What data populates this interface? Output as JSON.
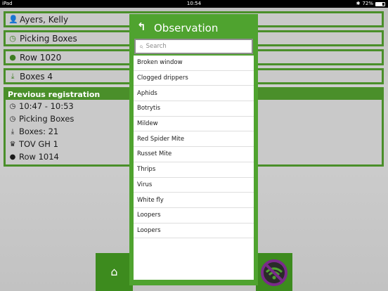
{
  "status_bar": {
    "carrier": "iPad",
    "time": "10:54",
    "battery": "72%"
  },
  "info": {
    "user": "Ayers, Kelly",
    "activity": "Picking Boxes",
    "row": "Row 1020",
    "boxes": "Boxes 4"
  },
  "previous": {
    "header": "Previous registration",
    "time_range": "10:47 - 10:53",
    "activity": "Picking Boxes",
    "boxes": "Boxes: 21",
    "location": "TOV GH 1",
    "row": "Row 1014"
  },
  "dialog": {
    "title": "Observation",
    "search_placeholder": "Search",
    "items": [
      "Broken window",
      "Clogged drippers",
      "Aphids",
      "Botrytis",
      "Mildew",
      "Red Spider Mite",
      "Russet Mite",
      "Thrips",
      "Virus",
      "White fly",
      "Loopers",
      "Loopers"
    ]
  },
  "colors": {
    "primary_green": "#4fa32f",
    "dark_green": "#3d8b1e",
    "border_green": "#4a8f2a",
    "wifi_off_purple": "#7a2a8a"
  },
  "icons": {
    "user": "user-icon",
    "clock": "clock-icon",
    "location": "location-pin-icon",
    "download": "download-icon",
    "crown": "crown-icon",
    "home": "home-icon",
    "wifi_off": "wifi-off-icon",
    "back": "back-arrow-icon",
    "search": "search-icon"
  }
}
